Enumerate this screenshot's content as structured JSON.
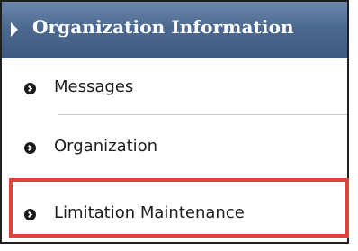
{
  "header": {
    "title": "Organization Information"
  },
  "menu": {
    "items": [
      {
        "label": "Messages"
      },
      {
        "label": "Organization"
      },
      {
        "label": "Limitation Maintenance"
      }
    ]
  },
  "colors": {
    "header_background": "#4d6a92",
    "header_text": "#ffffff",
    "highlight_border": "#e0413a",
    "bullet": "#1a1a1a"
  },
  "icons": {
    "header": "triangle-right-icon",
    "item_bullet": "circle-chevron-right-icon"
  }
}
